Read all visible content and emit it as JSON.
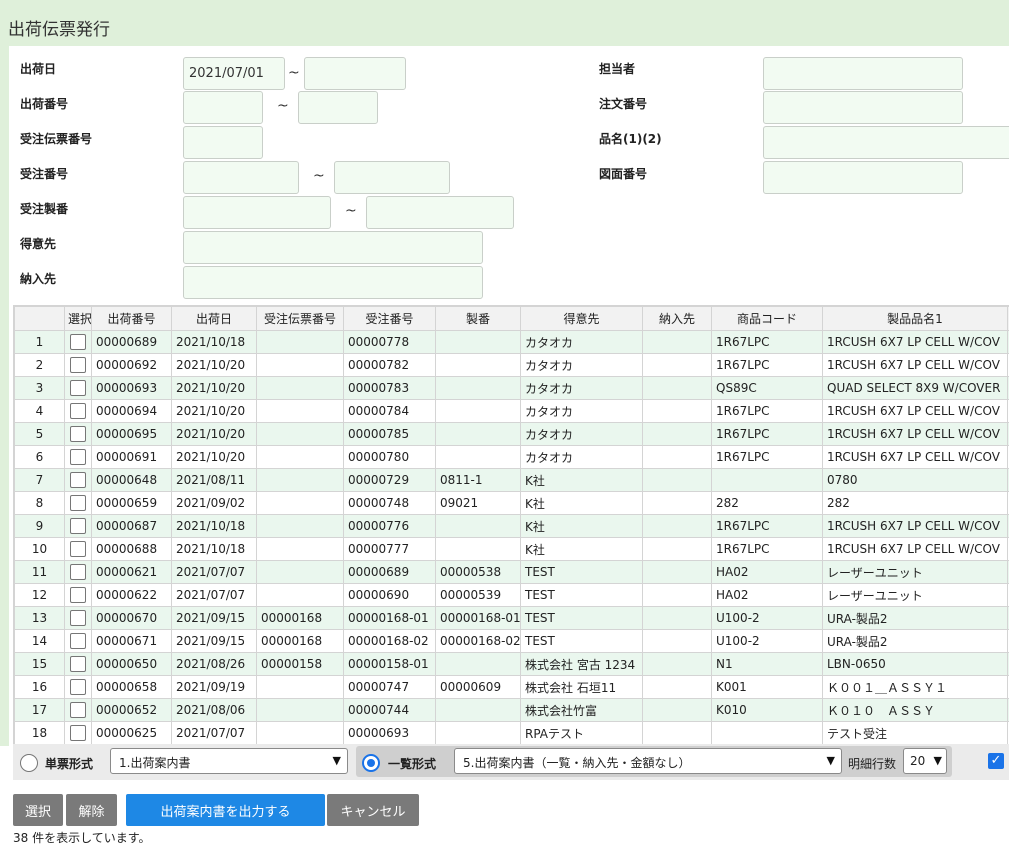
{
  "page": {
    "title": "出荷伝票発行"
  },
  "form": {
    "ship_date": {
      "label": "出荷日",
      "from": "2021/07/01",
      "to": ""
    },
    "ship_no": {
      "label": "出荷番号",
      "from": "",
      "to": ""
    },
    "order_slip_no": {
      "label": "受注伝票番号",
      "value": ""
    },
    "order_no": {
      "label": "受注番号",
      "from": "",
      "to": ""
    },
    "order_product_no": {
      "label": "受注製番",
      "from": "",
      "to": ""
    },
    "customer": {
      "label": "得意先",
      "value": ""
    },
    "delivery": {
      "label": "納入先",
      "value": ""
    },
    "staff": {
      "label": "担当者",
      "value": ""
    },
    "po_no": {
      "label": "注文番号",
      "value": ""
    },
    "item_name": {
      "label": "品名(1)(2)",
      "value": ""
    },
    "drawing_no": {
      "label": "図面番号",
      "value": ""
    },
    "tilde": "~"
  },
  "grid": {
    "columns": [
      "",
      "選択",
      "出荷番号",
      "出荷日",
      "受注伝票番号",
      "受注番号",
      "製番",
      "得意先",
      "納入先",
      "商品コード",
      "製品品名1"
    ],
    "rows": [
      [
        "1",
        "",
        "00000689",
        "2021/10/18",
        "",
        "00000778",
        "",
        "カタオカ",
        "",
        "1R67LPC",
        "1RCUSH 6X7 LP CELL W/COV"
      ],
      [
        "2",
        "",
        "00000692",
        "2021/10/20",
        "",
        "00000782",
        "",
        "カタオカ",
        "",
        "1R67LPC",
        "1RCUSH 6X7 LP CELL W/COV"
      ],
      [
        "3",
        "",
        "00000693",
        "2021/10/20",
        "",
        "00000783",
        "",
        "カタオカ",
        "",
        "QS89C",
        "QUAD SELECT 8X9 W/COVER"
      ],
      [
        "4",
        "",
        "00000694",
        "2021/10/20",
        "",
        "00000784",
        "",
        "カタオカ",
        "",
        "1R67LPC",
        "1RCUSH 6X7 LP CELL W/COV"
      ],
      [
        "5",
        "",
        "00000695",
        "2021/10/20",
        "",
        "00000785",
        "",
        "カタオカ",
        "",
        "1R67LPC",
        "1RCUSH 6X7 LP CELL W/COV"
      ],
      [
        "6",
        "",
        "00000691",
        "2021/10/20",
        "",
        "00000780",
        "",
        "カタオカ",
        "",
        "1R67LPC",
        "1RCUSH 6X7 LP CELL W/COV"
      ],
      [
        "7",
        "",
        "00000648",
        "2021/08/11",
        "",
        "00000729",
        "0811-1",
        "K社",
        "",
        "",
        "0780"
      ],
      [
        "8",
        "",
        "00000659",
        "2021/09/02",
        "",
        "00000748",
        "09021",
        "K社",
        "",
        "282",
        "282"
      ],
      [
        "9",
        "",
        "00000687",
        "2021/10/18",
        "",
        "00000776",
        "",
        "K社",
        "",
        "1R67LPC",
        "1RCUSH 6X7 LP CELL W/COV"
      ],
      [
        "10",
        "",
        "00000688",
        "2021/10/18",
        "",
        "00000777",
        "",
        "K社",
        "",
        "1R67LPC",
        "1RCUSH 6X7 LP CELL W/COV"
      ],
      [
        "11",
        "",
        "00000621",
        "2021/07/07",
        "",
        "00000689",
        "00000538",
        "TEST",
        "",
        "HA02",
        "レーザーユニット"
      ],
      [
        "12",
        "",
        "00000622",
        "2021/07/07",
        "",
        "00000690",
        "00000539",
        "TEST",
        "",
        "HA02",
        "レーザーユニット"
      ],
      [
        "13",
        "",
        "00000670",
        "2021/09/15",
        "00000168",
        "00000168-01",
        "00000168-01",
        "TEST",
        "",
        "U100-2",
        "URA-製品2"
      ],
      [
        "14",
        "",
        "00000671",
        "2021/09/15",
        "00000168",
        "00000168-02",
        "00000168-02",
        "TEST",
        "",
        "U100-2",
        "URA-製品2"
      ],
      [
        "15",
        "",
        "00000650",
        "2021/08/26",
        "00000158",
        "00000158-01",
        "",
        "株式会社 宮古 1234",
        "",
        "N1",
        "LBN-0650"
      ],
      [
        "16",
        "",
        "00000658",
        "2021/09/19",
        "",
        "00000747",
        "00000609",
        "株式会社 石垣11",
        "",
        "K001",
        "Ｋ００１＿ＡＳＳＹ１"
      ],
      [
        "17",
        "",
        "00000652",
        "2021/08/06",
        "",
        "00000744",
        "",
        "株式会社竹富",
        "",
        "K010",
        "Ｋ０１０　ＡＳＳＹ"
      ],
      [
        "18",
        "",
        "00000625",
        "2021/07/07",
        "",
        "00000693",
        "",
        "RPAテスト",
        "",
        "",
        "テスト受注"
      ]
    ]
  },
  "output": {
    "single_label": "単票形式",
    "single_select": "1.出荷案内書",
    "list_label": "一覧形式",
    "list_select": "5.出荷案内書（一覧・納入先・金額なし）",
    "lines_label": "明細行数",
    "lines_value": "20",
    "checkbox_mark": "✓"
  },
  "buttons": {
    "select": "選択",
    "clear": "解除",
    "print": "出荷案内書を出力する",
    "cancel": "キャンセル"
  },
  "status": "38 件を表示しています。"
}
